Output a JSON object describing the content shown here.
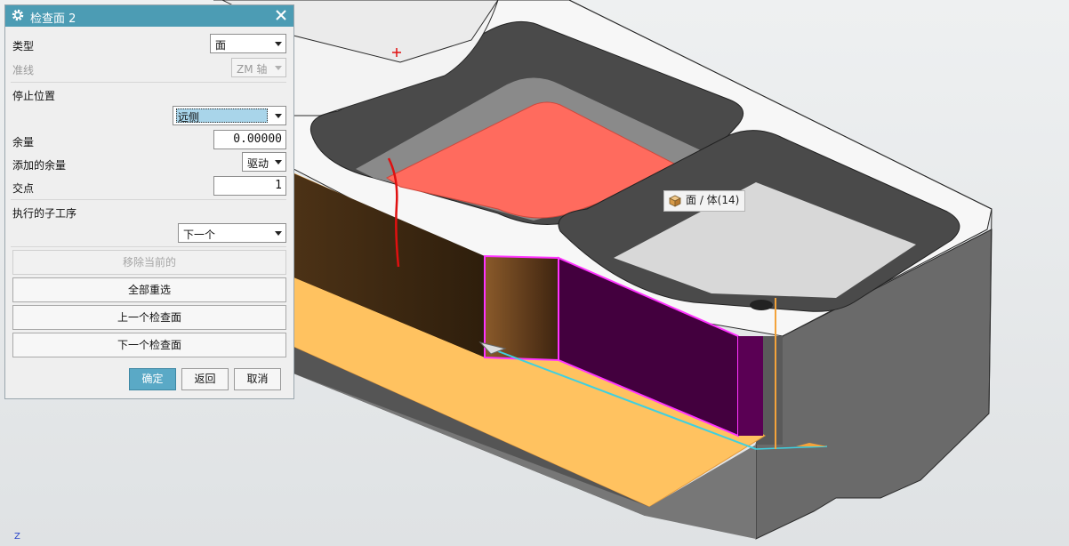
{
  "dialog": {
    "title": "检查面 2",
    "type_label": "类型",
    "type_value": "面",
    "guide_label": "准线",
    "guide_value": "ZM 轴",
    "stop_position_label": "停止位置",
    "stop_position_value": "远侧",
    "stock_label": "余量",
    "stock_value": "0.00000",
    "added_stock_label": "添加的余量",
    "added_stock_value": "驱动",
    "intersection_label": "交点",
    "intersection_value": "1",
    "sub_op_label": "执行的子工序",
    "sub_op_value": "下一个",
    "buttons": {
      "remove_current": "移除当前的",
      "reselect_all": "全部重选",
      "previous_check": "上一个检查面",
      "next_check": "下一个检查面"
    },
    "actions": {
      "ok": "确定",
      "back": "返回",
      "cancel": "取消"
    }
  },
  "tooltip": {
    "text": "面 / 体(14)",
    "icon": "cube-icon"
  },
  "axis_triad": {
    "z_label": "Z"
  },
  "colors": {
    "titlebar": "#4c9cb4",
    "highlight_face": "#ff6b5e",
    "orange_face": "#ffc260",
    "magenta_edge": "#ff33ff",
    "cyan_axis": "#3fd0e0"
  }
}
